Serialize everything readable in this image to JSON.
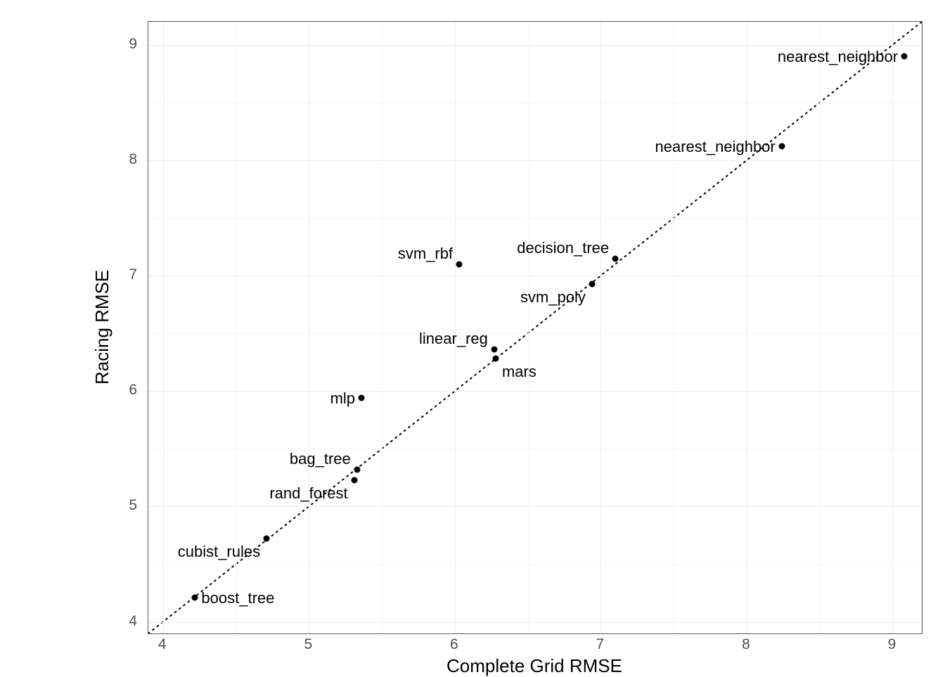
{
  "chart_data": {
    "type": "scatter",
    "xlabel": "Complete Grid RMSE",
    "ylabel": "Racing RMSE",
    "xlim": [
      3.9,
      9.2
    ],
    "ylim": [
      3.9,
      9.2
    ],
    "x_ticks": [
      4,
      5,
      6,
      7,
      8,
      9
    ],
    "y_ticks": [
      4,
      5,
      6,
      7,
      8,
      9
    ],
    "x_minor": [
      4.5,
      5.5,
      6.5,
      7.5,
      8.5
    ],
    "y_minor": [
      4.5,
      5.5,
      6.5,
      7.5,
      8.5
    ],
    "reference_line": {
      "type": "diagonal",
      "slope": 1,
      "intercept": 0,
      "style": "dotted"
    },
    "points": [
      {
        "label": "boost_tree",
        "x": 4.22,
        "y": 4.21,
        "halign": "left"
      },
      {
        "label": "cubist_rules",
        "x": 4.71,
        "y": 4.72,
        "halign": "right"
      },
      {
        "label": "rand_forest",
        "x": 5.31,
        "y": 5.23,
        "halign": "right"
      },
      {
        "label": "bag_tree",
        "x": 5.33,
        "y": 5.32,
        "halign": "right"
      },
      {
        "label": "mlp",
        "x": 5.36,
        "y": 5.94,
        "halign": "right"
      },
      {
        "label": "mars",
        "x": 6.28,
        "y": 6.28,
        "halign": "left"
      },
      {
        "label": "linear_reg",
        "x": 6.27,
        "y": 6.36,
        "halign": "right"
      },
      {
        "label": "svm_poly",
        "x": 6.94,
        "y": 6.93,
        "halign": "right"
      },
      {
        "label": "svm_rbf",
        "x": 6.03,
        "y": 7.1,
        "halign": "right"
      },
      {
        "label": "decision_tree",
        "x": 7.1,
        "y": 7.15,
        "halign": "right"
      },
      {
        "label": "nearest_neighbor",
        "x": 8.24,
        "y": 8.12,
        "halign": "right"
      },
      {
        "label": "nearest_neighbor",
        "x": 9.08,
        "y": 8.9,
        "halign": "right"
      }
    ]
  }
}
